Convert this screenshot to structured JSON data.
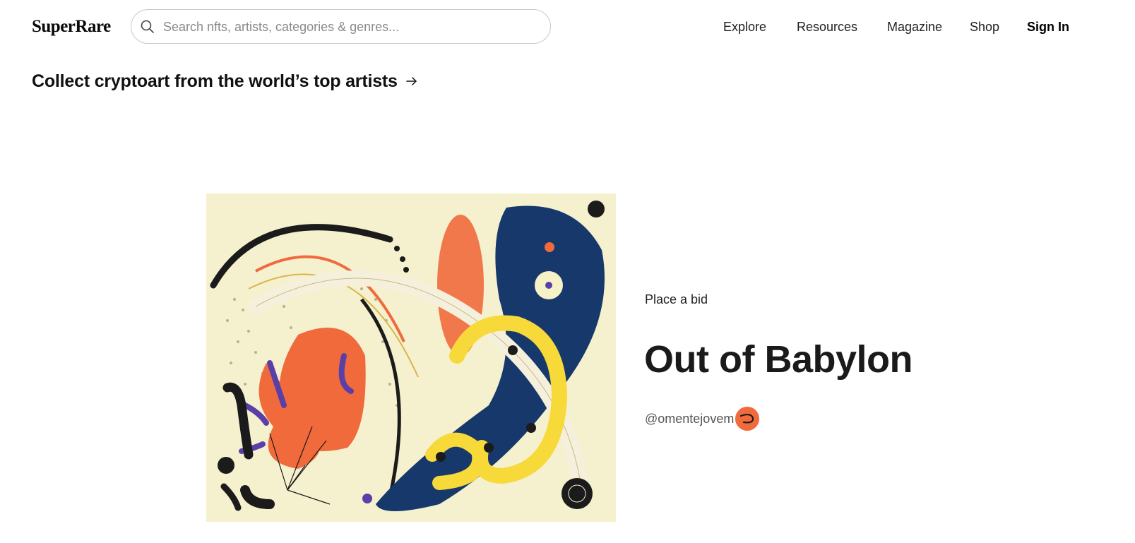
{
  "header": {
    "logo": "SuperRare",
    "search": {
      "placeholder": "Search nfts, artists, categories & genres...",
      "value": "",
      "icon": "search-icon"
    },
    "nav": {
      "explore": "Explore",
      "resources": "Resources",
      "magazine": "Magazine",
      "shop": "Shop",
      "sign_in": "Sign In"
    }
  },
  "hero": {
    "tagline": "Collect cryptoart from the world’s top artists",
    "tagline_icon": "arrow-right-icon",
    "featured": {
      "bid_label": "Place a bid",
      "title": "Out of Babylon",
      "artist_handle": "@omentejovem",
      "avatar_color": "#f06a3c"
    }
  },
  "colors": {
    "artwork_background": "#f5f1cf",
    "artwork_navy": "#17386b",
    "artwork_orange": "#f06a3c",
    "artwork_yellow": "#f7d93a",
    "artwork_purple": "#5a3fa8"
  }
}
